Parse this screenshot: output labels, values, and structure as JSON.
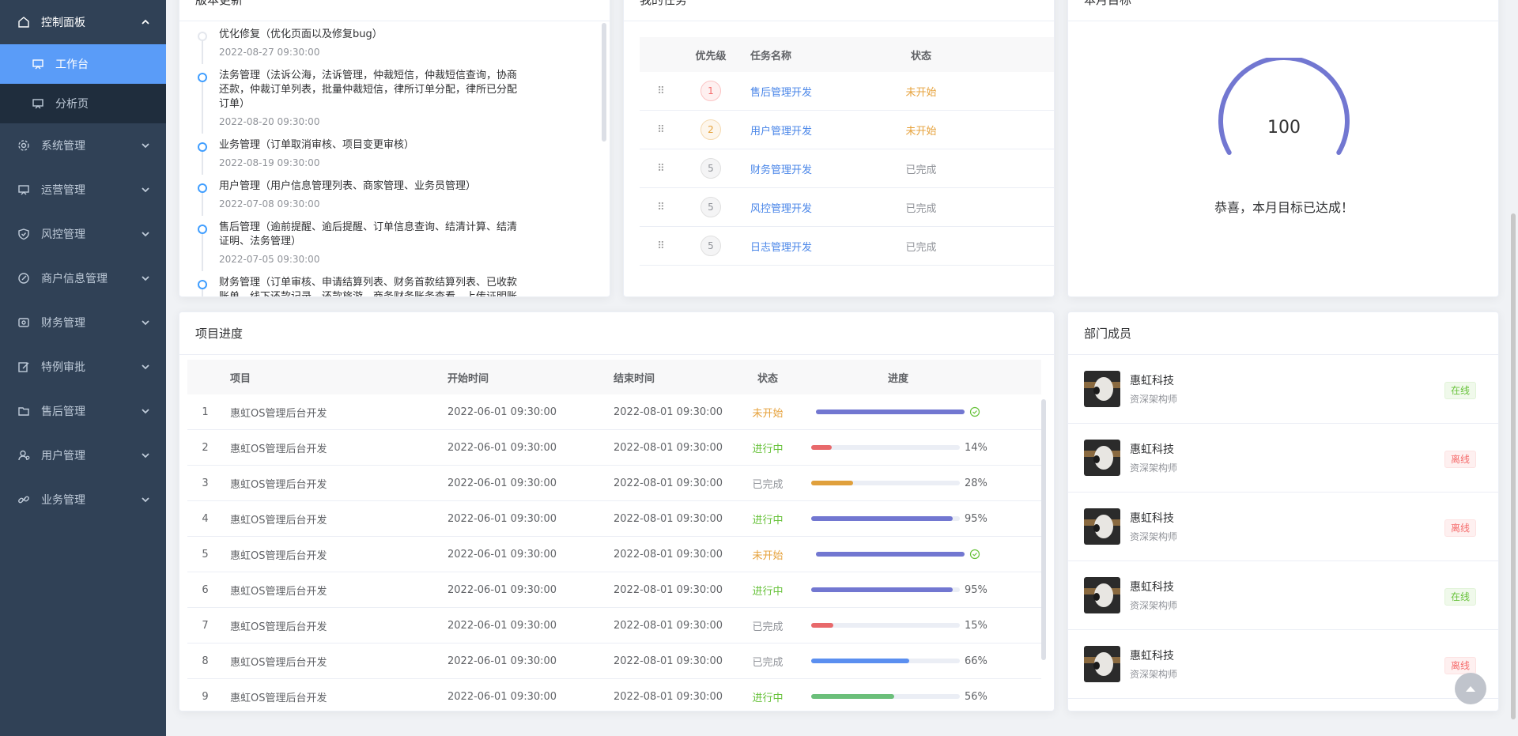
{
  "sidebar": {
    "dashboard": "控制面板",
    "sub_items": [
      {
        "label": "工作台",
        "icon": "presentation-icon"
      },
      {
        "label": "分析页",
        "icon": "chart-icon"
      }
    ],
    "items": [
      {
        "label": "系统管理",
        "icon": "gear-icon"
      },
      {
        "label": "运营管理",
        "icon": "presentation-icon"
      },
      {
        "label": "风控管理",
        "icon": "shield-icon"
      },
      {
        "label": "商户信息管理",
        "icon": "edit-circle-icon"
      },
      {
        "label": "财务管理",
        "icon": "wallet-icon"
      },
      {
        "label": "特例审批",
        "icon": "edit-icon"
      },
      {
        "label": "售后管理",
        "icon": "folder-icon"
      },
      {
        "label": "用户管理",
        "icon": "user-icon"
      },
      {
        "label": "业务管理",
        "icon": "link-icon"
      }
    ]
  },
  "version_card": {
    "title": "版本更新",
    "items": [
      {
        "title": "优化修复（优化页面以及修复bug）",
        "time": "2022-08-27 09:30:00",
        "dot": "grey"
      },
      {
        "title": "法务管理（法诉公海，法诉管理，仲裁短信，仲裁短信查询，协商还款，仲裁订单列表，批量仲裁短信，律所订单分配，律所已分配订单）",
        "time": "2022-08-20 09:30:00",
        "dot": "blue"
      },
      {
        "title": "业务管理（订单取消审核、项目变更审核）",
        "time": "2022-08-19 09:30:00",
        "dot": "blue"
      },
      {
        "title": "用户管理（用户信息管理列表、商家管理、业务员管理）",
        "time": "2022-07-08 09:30:00",
        "dot": "blue"
      },
      {
        "title": "售后管理（逾前提醒、逾后提醒、订单信息查询、结清计算、结清证明、法务管理）",
        "time": "2022-07-05 09:30:00",
        "dot": "blue"
      },
      {
        "title": "财务管理（订单审核、申请结算列表、财务首款结算列表、已收款账单、线下还款记录、还款旅游、商务财务账务查看、上传证明账务查看、上传证明",
        "time": "",
        "dot": "blue"
      }
    ]
  },
  "task_card": {
    "title": "我的任务",
    "headers": {
      "priority": "优先级",
      "name": "任务名称",
      "status": "状态"
    },
    "rows": [
      {
        "priority": "1",
        "name": "售后管理开发",
        "status": "未开始"
      },
      {
        "priority": "2",
        "name": "用户管理开发",
        "status": "未开始"
      },
      {
        "priority": "5",
        "name": "财务管理开发",
        "status": "已完成"
      },
      {
        "priority": "5",
        "name": "风控管理开发",
        "status": "已完成"
      },
      {
        "priority": "5",
        "name": "日志管理开发",
        "status": "已完成"
      }
    ]
  },
  "goal_card": {
    "title": "本月目标",
    "value": "100",
    "progress": 1.0,
    "color": "#7277d1",
    "caption": "恭喜，本月目标已达成！"
  },
  "project_card": {
    "title": "项目进度",
    "headers": {
      "name": "项目",
      "start": "开始时间",
      "end": "结束时间",
      "status": "状态",
      "progress": "进度"
    },
    "rows": [
      {
        "idx": "1",
        "name": "惠虹OS管理后台开发",
        "start": "2022-06-01 09:30:00",
        "end": "2022-08-01 09:30:00",
        "status": "未开始",
        "progress": 100,
        "pct": "",
        "color": "#7277d1"
      },
      {
        "idx": "2",
        "name": "惠虹OS管理后台开发",
        "start": "2022-06-01 09:30:00",
        "end": "2022-08-01 09:30:00",
        "status": "进行中",
        "progress": 14,
        "pct": "14%",
        "color": "#e8696b"
      },
      {
        "idx": "3",
        "name": "惠虹OS管理后台开发",
        "start": "2022-06-01 09:30:00",
        "end": "2022-08-01 09:30:00",
        "status": "已完成",
        "progress": 28,
        "pct": "28%",
        "color": "#e0a03c"
      },
      {
        "idx": "4",
        "name": "惠虹OS管理后台开发",
        "start": "2022-06-01 09:30:00",
        "end": "2022-08-01 09:30:00",
        "status": "进行中",
        "progress": 95,
        "pct": "95%",
        "color": "#7277d1"
      },
      {
        "idx": "5",
        "name": "惠虹OS管理后台开发",
        "start": "2022-06-01 09:30:00",
        "end": "2022-08-01 09:30:00",
        "status": "未开始",
        "progress": 100,
        "pct": "",
        "color": "#7277d1"
      },
      {
        "idx": "6",
        "name": "惠虹OS管理后台开发",
        "start": "2022-06-01 09:30:00",
        "end": "2022-08-01 09:30:00",
        "status": "进行中",
        "progress": 95,
        "pct": "95%",
        "color": "#7277d1"
      },
      {
        "idx": "7",
        "name": "惠虹OS管理后台开发",
        "start": "2022-06-01 09:30:00",
        "end": "2022-08-01 09:30:00",
        "status": "已完成",
        "progress": 15,
        "pct": "15%",
        "color": "#e8696b"
      },
      {
        "idx": "8",
        "name": "惠虹OS管理后台开发",
        "start": "2022-06-01 09:30:00",
        "end": "2022-08-01 09:30:00",
        "status": "已完成",
        "progress": 66,
        "pct": "66%",
        "color": "#5b8ff0"
      },
      {
        "idx": "9",
        "name": "惠虹OS管理后台开发",
        "start": "2022-06-01 09:30:00",
        "end": "2022-08-01 09:30:00",
        "status": "进行中",
        "progress": 56,
        "pct": "56%",
        "color": "#6bbf7a"
      }
    ]
  },
  "members_card": {
    "title": "部门成员",
    "members": [
      {
        "name": "惠虹科技",
        "role": "资深架构师",
        "status": "在线"
      },
      {
        "name": "惠虹科技",
        "role": "资深架构师",
        "status": "离线"
      },
      {
        "name": "惠虹科技",
        "role": "资深架构师",
        "status": "离线"
      },
      {
        "name": "惠虹科技",
        "role": "资深架构师",
        "status": "在线"
      },
      {
        "name": "惠虹科技",
        "role": "资深架构师",
        "status": "离线"
      }
    ]
  },
  "status_colors": {
    "未开始": "#e6a23c",
    "进行中": "#67c23a",
    "已完成": "#909399"
  }
}
